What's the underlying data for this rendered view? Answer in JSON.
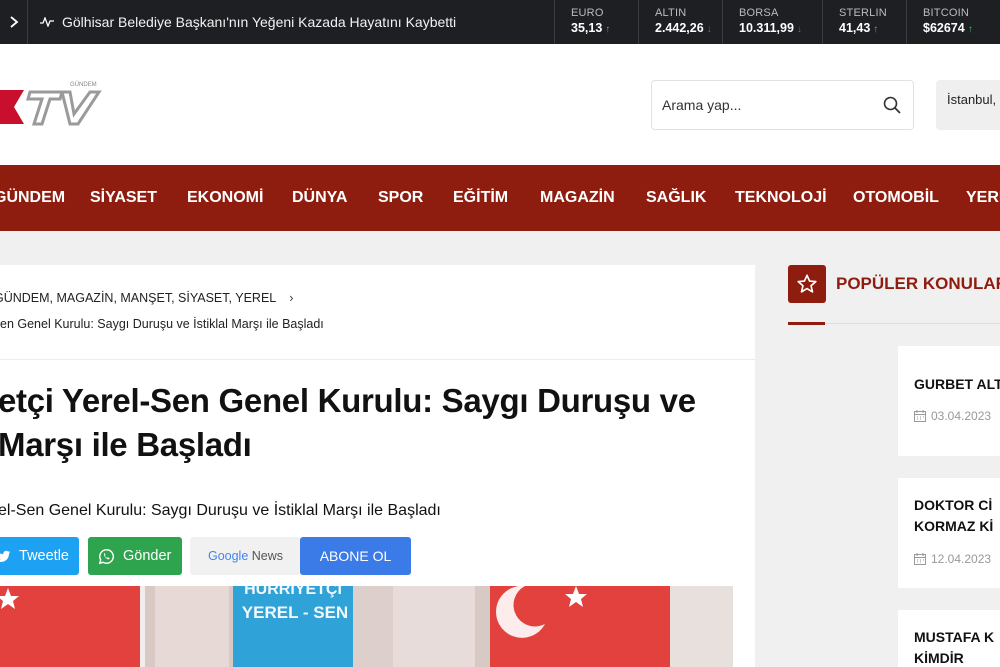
{
  "ticker": {
    "headline": "Gölhisar Belediye Başkanı'nın Yeğeni Kazada Hayatını Kaybetti",
    "markets": [
      {
        "name": "EURO",
        "value": "35,13",
        "trend": "up"
      },
      {
        "name": "ALTIN",
        "value": "2.442,26",
        "trend": "down"
      },
      {
        "name": "BORSA",
        "value": "10.311,99",
        "trend": "down"
      },
      {
        "name": "STERLIN",
        "value": "41,43",
        "trend": "up"
      },
      {
        "name": "BITCOIN",
        "value": "$62674",
        "trend": "up"
      }
    ]
  },
  "header": {
    "logo_text": "KTV",
    "logo_tag": "GÜNDEM",
    "search_placeholder": "Arama yap...",
    "weather_city": "İstanbul,"
  },
  "nav": {
    "items": [
      "GÜNDEM",
      "SİYASET",
      "EKONOMİ",
      "DÜNYA",
      "SPOR",
      "EĞİTİM",
      "MAGAZİN",
      "SAĞLIK",
      "TEKNOLOJİ",
      "OTOMOBİL",
      "YEREL"
    ]
  },
  "article": {
    "categories": "GÜNDEM, MAGAZİN, MANŞET, SİYASET, YEREL",
    "crumb_title": "en Genel Kurulu: Saygı Duruşu ve İstiklal Marşı ile Başladı",
    "title_line1": "etçi Yerel-Sen Genel Kurulu: Saygı Duruşu ve",
    "title_line2": "Marşı ile Başladı",
    "summary": "el-Sen Genel Kurulu: Saygı Duruşu ve İstiklal Marşı ile Başladı",
    "share": {
      "tweet": "Tweetle",
      "whatsapp": "Gönder",
      "google_news_brand": "Google",
      "google_news_label": "News",
      "subscribe": "ABONE OL"
    },
    "photo_text_1": "HÜRRİYETÇİ",
    "photo_text_2": "YEREL - SEN"
  },
  "sidebar": {
    "title": "POPÜLER KONULAR",
    "items": [
      {
        "title_1": "GURBET ALT",
        "title_2": "",
        "date": "03.04.2023"
      },
      {
        "title_1": "DOKTOR Cİ",
        "title_2": "KORMAZ Kİ",
        "date": "12.04.2023"
      },
      {
        "title_1": "MUSTAFA K",
        "title_2": "KİMDİR",
        "date": ""
      }
    ]
  },
  "colors": {
    "brand": "#8f1d0f",
    "topbar": "#1d1f23",
    "tweet": "#1da1f2",
    "whatsapp": "#2ea44f",
    "subscribe": "#3b7be8"
  }
}
